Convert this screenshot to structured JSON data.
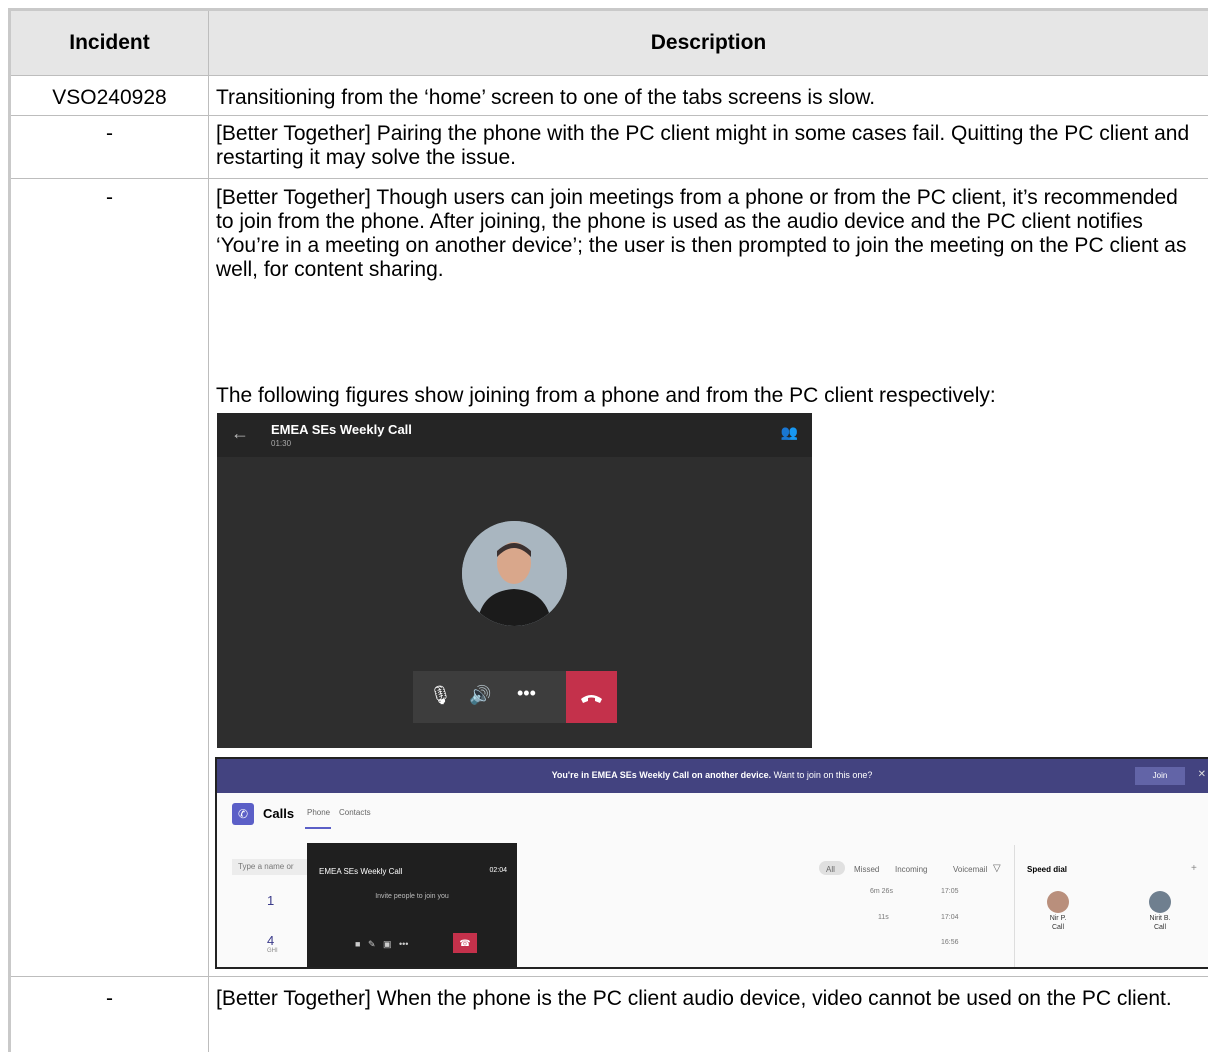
{
  "table": {
    "header_incident": "Incident",
    "header_description": "Description",
    "rows": [
      {
        "incident": "VSO240928",
        "description": "Transitioning from the ‘home’ screen to one of the tabs screens is slow."
      },
      {
        "incident": "-",
        "description": "[Better Together] Pairing the phone with the PC client might in some cases fail. Quitting the PC client and restarting it may solve the issue."
      },
      {
        "incident": "-",
        "description": "[Better Together] Though users can join meetings from a phone or from the PC client, it’s recommended to join from the phone. After joining, the phone is used as the audio device and the PC client notifies ‘You’re in a meeting on another device’; the user is then prompted to join the meeting on the PC client as well, for content sharing.",
        "note": "The following figures show joining from a phone and from the PC client respectively:"
      },
      {
        "incident": "-",
        "description": "[Better Together] When the phone is the PC client audio device, video cannot be used on the PC client."
      }
    ]
  },
  "phone_screenshot": {
    "title": "EMEA SEs Weekly Call",
    "duration": "01:30",
    "back_icon": "arrow-left-icon",
    "participants_icon": "add-people-icon",
    "controls": [
      "mic-off-icon",
      "speaker-icon",
      "more-icon",
      "hang-up-icon"
    ]
  },
  "pc_screenshot": {
    "banner_bold": "You're in EMEA SEs Weekly Call on another device.",
    "banner_rest": "Want to join on this one?",
    "join_label": "Join",
    "app_title": "Calls",
    "tabs": [
      "Phone",
      "Contacts"
    ],
    "search_placeholder": "Type a name or",
    "dial_digits": [
      "1",
      "4"
    ],
    "dial_sub": "GHI",
    "filters": [
      "All",
      "Missed",
      "Incoming",
      "Voicemail"
    ],
    "rows": [
      {
        "duration": "6m 26s",
        "time": "17:05"
      },
      {
        "duration": "11s",
        "time": "17:04"
      },
      {
        "duration": "",
        "time": "16:56"
      }
    ],
    "speed_dial_title": "Speed dial",
    "speed_dial": [
      {
        "name": "Nir P.",
        "action": "Call"
      },
      {
        "name": "Nirit B.",
        "action": "Call"
      }
    ],
    "popup_title": "EMEA SEs Weekly Call",
    "popup_time": "02:04",
    "popup_invite": "Invite people to join you"
  }
}
